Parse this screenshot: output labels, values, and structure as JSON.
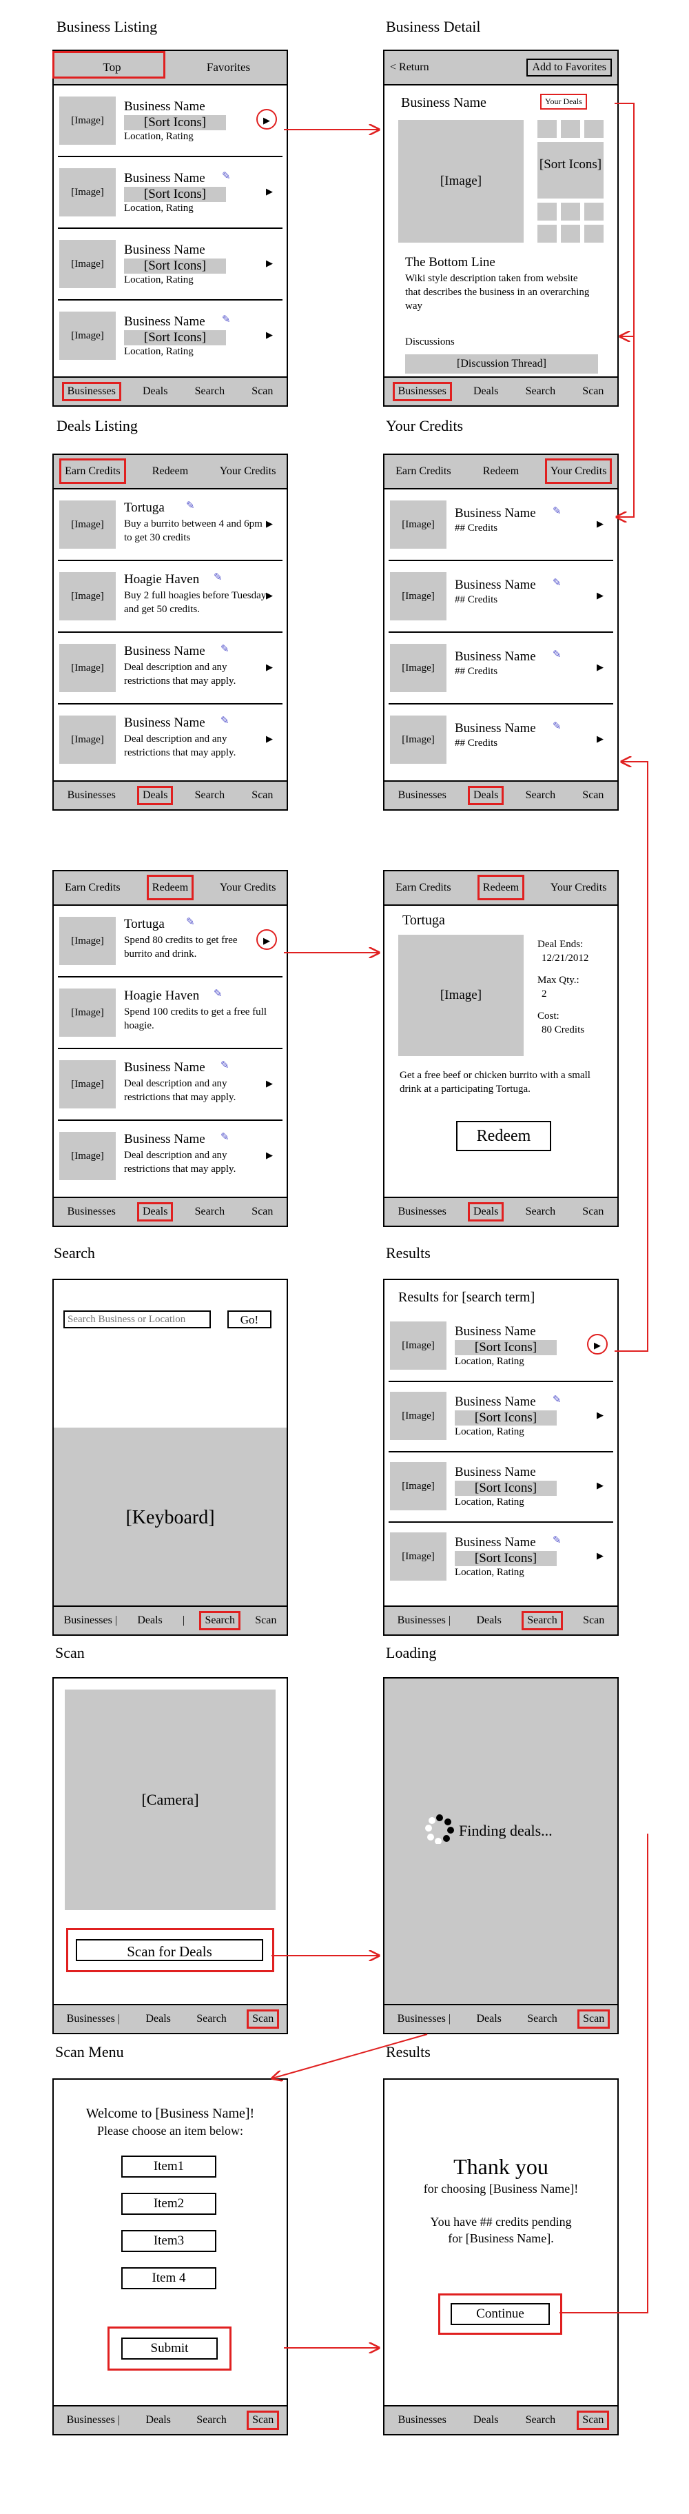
{
  "titles": {
    "business_listing": "Business Listing",
    "business_detail": "Business Detail",
    "deals_listing": "Deals Listing",
    "your_credits": "Your Credits",
    "search": "Search",
    "results": "Results",
    "scan": "Scan",
    "loading": "Loading",
    "scan_menu": "Scan Menu",
    "results2": "Results"
  },
  "tabs": {
    "businesses": "Businesses",
    "deals": "Deals",
    "search": "Search",
    "scan": "Scan"
  },
  "tabs_pipe": {
    "businesses": "Businesses |"
  },
  "pipe": "|",
  "business_listing": {
    "tab_top": "Top",
    "tab_favorites": "Favorites",
    "items": [
      {
        "image": "[Image]",
        "name": "Business Name",
        "sort": "[Sort Icons]",
        "sub": "Location, Rating"
      },
      {
        "image": "[Image]",
        "name": "Business Name",
        "sort": "[Sort Icons]",
        "sub": "Location, Rating"
      },
      {
        "image": "[Image]",
        "name": "Business Name",
        "sort": "[Sort Icons]",
        "sub": "Location, Rating"
      },
      {
        "image": "[Image]",
        "name": "Business Name",
        "sort": "[Sort Icons]",
        "sub": "Location, Rating"
      }
    ]
  },
  "business_detail": {
    "return": "< Return",
    "add_fav": "Add to Favorites",
    "name": "Business Name",
    "your_deals": "Your Deals",
    "image": "[Image]",
    "sort": "[Sort Icons]",
    "bottom_line": "The Bottom Line",
    "wiki": "Wiki style description taken from website that describes the business in an overarching way",
    "discussions": "Discussions",
    "thread": "[Discussion Thread]"
  },
  "deals_tabs": {
    "earn": "Earn Credits",
    "redeem": "Redeem",
    "your": "Your Credits"
  },
  "deals_listing": {
    "items": [
      {
        "image": "[Image]",
        "title": "Tortuga",
        "desc": "Buy a burrito between 4 and 6pm to get 30 credits"
      },
      {
        "image": "[Image]",
        "title": "Hoagie Haven",
        "desc": "Buy 2 full hoagies before Tuesday and get 50 credits."
      },
      {
        "image": "[Image]",
        "title": "Business Name",
        "desc": "Deal description and any restrictions that may apply."
      },
      {
        "image": "[Image]",
        "title": "Business Name",
        "desc": "Deal description and any restrictions that may apply."
      }
    ]
  },
  "your_credits": {
    "items": [
      {
        "image": "[Image]",
        "name": "Business Name",
        "credits": "## Credits"
      },
      {
        "image": "[Image]",
        "name": "Business Name",
        "credits": "## Credits"
      },
      {
        "image": "[Image]",
        "name": "Business Name",
        "credits": "## Credits"
      },
      {
        "image": "[Image]",
        "name": "Business Name",
        "credits": "## Credits"
      }
    ]
  },
  "redeem_listing": {
    "items": [
      {
        "image": "[Image]",
        "title": "Tortuga",
        "desc": "Spend 80 credits to get free burrito and drink."
      },
      {
        "image": "[Image]",
        "title": "Hoagie Haven",
        "desc": "Spend 100 credits to get a free full hoagie."
      },
      {
        "image": "[Image]",
        "title": "Business Name",
        "desc": "Deal description and any restrictions that may apply."
      },
      {
        "image": "[Image]",
        "title": "Business Name",
        "desc": "Deal description and any restrictions that may apply."
      }
    ]
  },
  "redeem_detail": {
    "title": "Tortuga",
    "image": "[Image]",
    "deal_ends_label": "Deal Ends:",
    "deal_ends": "12/21/2012",
    "max_qty_label": "Max Qty.:",
    "max_qty": "2",
    "cost_label": "Cost:",
    "cost": "80 Credits",
    "desc": "Get a free beef or chicken burrito with a small drink at a participating Tortuga.",
    "redeem": "Redeem"
  },
  "search": {
    "placeholder": "Search Business or Location",
    "go": "Go!",
    "keyboard": "[Keyboard]"
  },
  "results": {
    "heading": "Results for [search term]",
    "items": [
      {
        "image": "[Image]",
        "name": "Business Name",
        "sort": "[Sort Icons]",
        "sub": "Location, Rating"
      },
      {
        "image": "[Image]",
        "name": "Business Name",
        "sort": "[Sort Icons]",
        "sub": "Location, Rating"
      },
      {
        "image": "[Image]",
        "name": "Business Name",
        "sort": "[Sort Icons]",
        "sub": "Location, Rating"
      },
      {
        "image": "[Image]",
        "name": "Business Name",
        "sort": "[Sort Icons]",
        "sub": "Location, Rating"
      }
    ]
  },
  "scan": {
    "camera": "[Camera]",
    "button": "Scan for Deals"
  },
  "loading": {
    "text": "Finding deals..."
  },
  "scan_menu": {
    "welcome": "Welcome to [Business Name]!",
    "prompt": "Please choose an item below:",
    "items": [
      "Item1",
      "Item2",
      "Item3",
      "Item 4"
    ],
    "submit": "Submit"
  },
  "thanks": {
    "title": "Thank you",
    "line1": "for choosing [Business Name]!",
    "line2": "You have ## credits pending",
    "line3": "for [Business Name].",
    "continue": "Continue"
  }
}
